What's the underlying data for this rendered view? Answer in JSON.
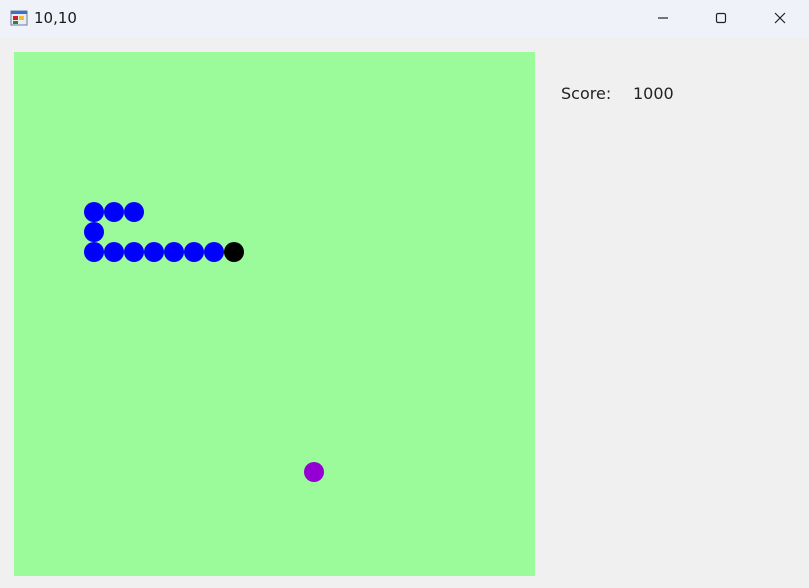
{
  "window": {
    "title": "10,10",
    "icon": "windows-form-icon"
  },
  "controls": {
    "minimize_icon": "minimize-icon",
    "maximize_icon": "maximize-icon",
    "close_icon": "close-icon"
  },
  "score": {
    "label": "Score:",
    "value": "1000"
  },
  "game": {
    "cell_grid_note": "",
    "colors": {
      "board": "#9bfb9b",
      "snake_body": "#0000ff",
      "snake_head": "#000000",
      "food": "#9400d3"
    },
    "snake": {
      "head": [
        11,
        10
      ],
      "body": [
        [
          10,
          10
        ],
        [
          9,
          10
        ],
        [
          8,
          10
        ],
        [
          7,
          10
        ],
        [
          6,
          10
        ],
        [
          5,
          10
        ],
        [
          4,
          10
        ],
        [
          4,
          9
        ],
        [
          4,
          8
        ],
        [
          5,
          8
        ],
        [
          6,
          8
        ]
      ]
    },
    "food": [
      15,
      21
    ]
  }
}
